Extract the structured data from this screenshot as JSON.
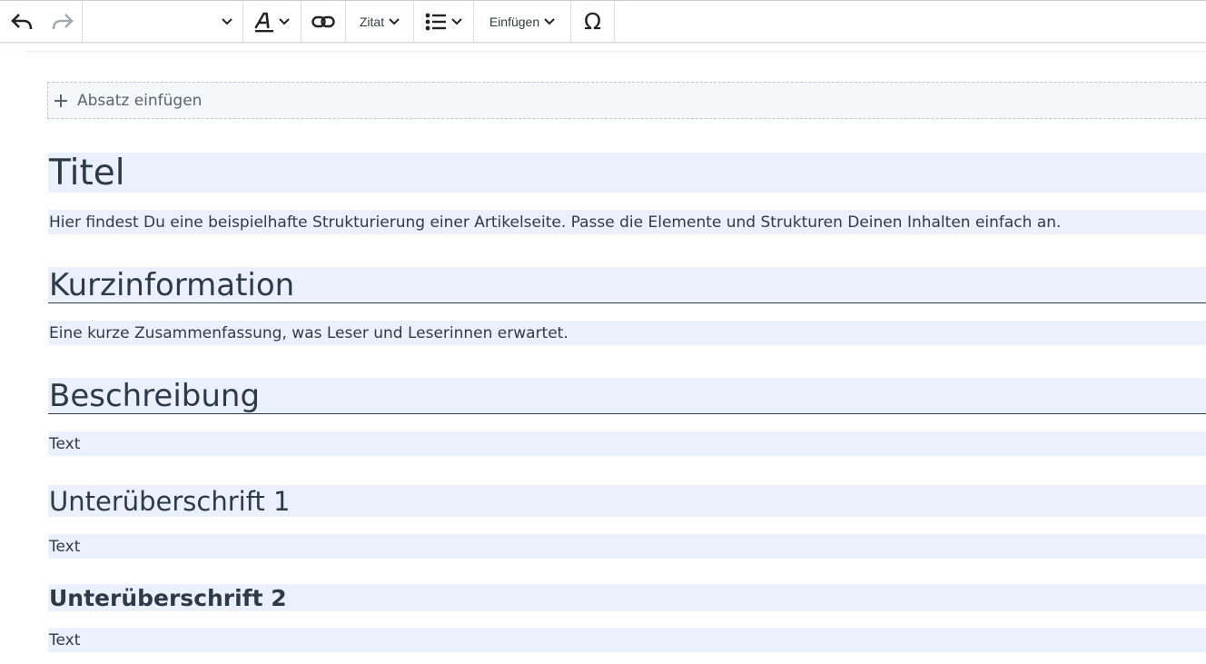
{
  "toolbar": {
    "undo_icon": "undo-icon",
    "redo_icon": "redo-icon",
    "paragraph_style_value": "",
    "text_style_icon": "text-style-icon",
    "link_icon": "link-icon",
    "quote_label": "Zitat",
    "list_icon": "bulleted-list-icon",
    "insert_label": "Einfügen",
    "special_chars_label": "Ω"
  },
  "editor": {
    "add_paragraph_label": "Absatz einfügen",
    "blocks": [
      {
        "type": "h1",
        "text": "Titel"
      },
      {
        "type": "p",
        "text": "Hier findest Du eine beispielhafte Strukturierung einer Artikelseite. Passe die Elemente und Strukturen Deinen Inhalten einfach an."
      },
      {
        "type": "h2",
        "text": "Kurzinformation"
      },
      {
        "type": "p",
        "text": "Eine kurze Zusammenfassung, was Leser und Leserinnen erwartet."
      },
      {
        "type": "h2",
        "text": "Beschreibung"
      },
      {
        "type": "p",
        "text": "Text"
      },
      {
        "type": "h3",
        "text": "Unterüberschrift 1"
      },
      {
        "type": "p",
        "text": "Text"
      },
      {
        "type": "h4",
        "text": "Unterüberschrift 2"
      },
      {
        "type": "p",
        "text": "Text"
      }
    ]
  },
  "colors": {
    "block_highlight": "#eaf1fc",
    "text": "#333a44",
    "heading": "#2e3a48"
  }
}
